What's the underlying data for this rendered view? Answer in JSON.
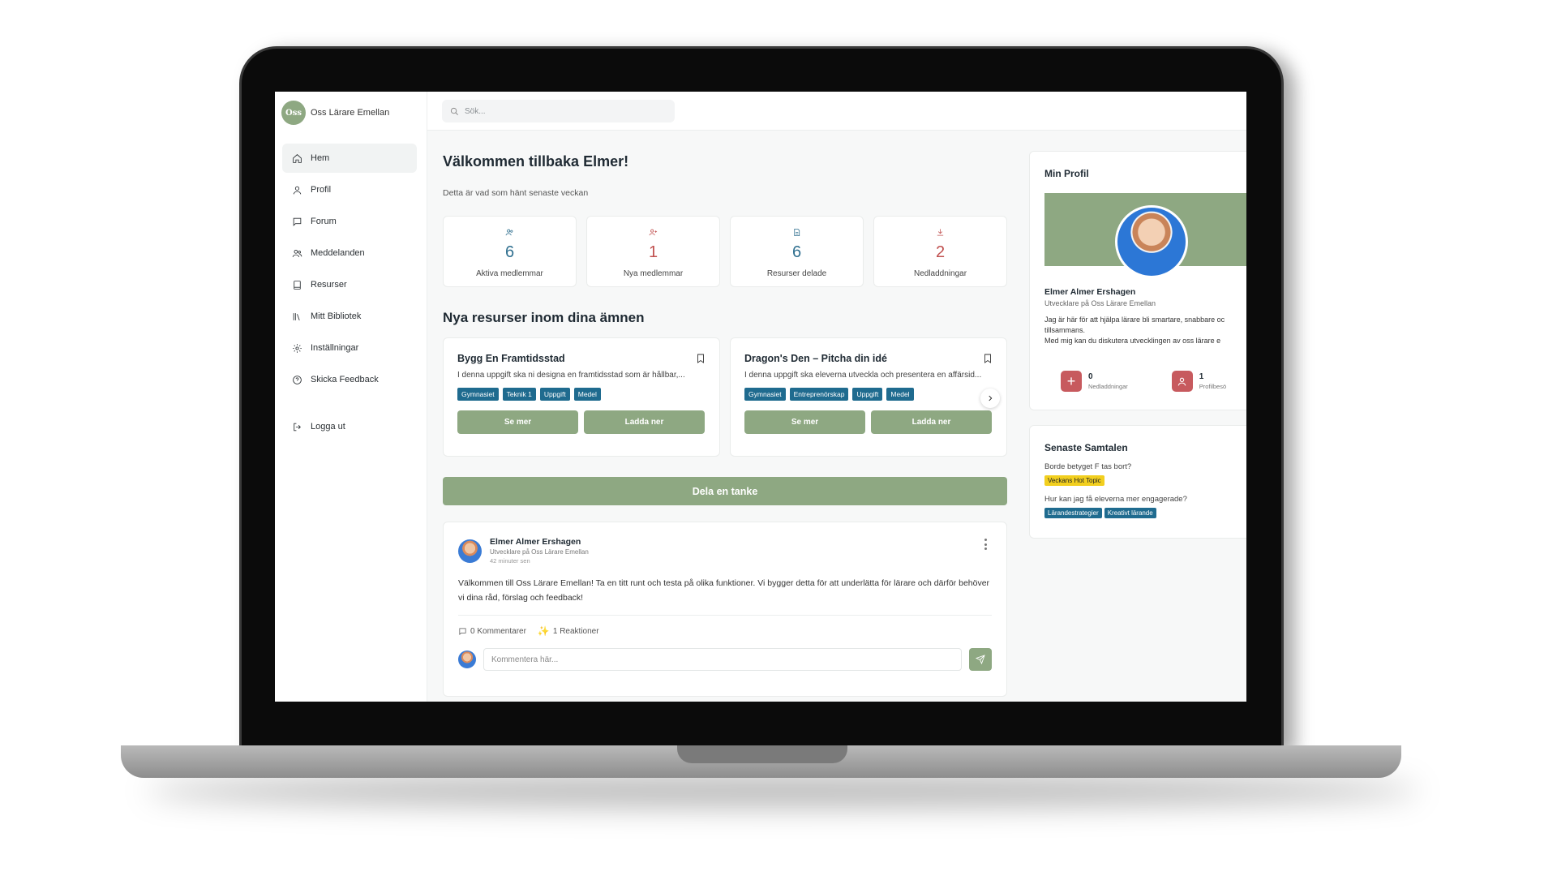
{
  "brand": {
    "logo_text": "Oss",
    "name": "Oss Lärare Emellan"
  },
  "search": {
    "placeholder": "Sök..."
  },
  "sidebar": {
    "items": [
      {
        "label": "Hem",
        "icon": "home-icon"
      },
      {
        "label": "Profil",
        "icon": "user-icon"
      },
      {
        "label": "Forum",
        "icon": "chat-icon"
      },
      {
        "label": "Meddelanden",
        "icon": "users-icon"
      },
      {
        "label": "Resurser",
        "icon": "book-icon"
      },
      {
        "label": "Mitt Bibliotek",
        "icon": "library-icon"
      },
      {
        "label": "Inställningar",
        "icon": "gear-icon"
      },
      {
        "label": "Skicka Feedback",
        "icon": "help-icon"
      }
    ],
    "logout": "Logga ut"
  },
  "main": {
    "welcome": "Välkommen tillbaka Elmer!",
    "subtitle": "Detta är vad som hänt senaste veckan",
    "stats": [
      {
        "value": "6",
        "label": "Aktiva medlemmar",
        "icon": "users-icon",
        "color": "#2f6f8f"
      },
      {
        "value": "1",
        "label": "Nya medlemmar",
        "icon": "user-plus-icon",
        "color": "#c0504f"
      },
      {
        "value": "6",
        "label": "Resurser delade",
        "icon": "file-icon",
        "color": "#2f6f8f"
      },
      {
        "value": "2",
        "label": "Nedladdningar",
        "icon": "download-icon",
        "color": "#c0504f"
      }
    ],
    "resources_title": "Nya resurser inom dina ämnen",
    "resources": [
      {
        "title": "Bygg En Framtidsstad",
        "description": "I denna uppgift ska ni designa en framtidsstad som är hållbar,...",
        "tags": [
          "Gymnasiet",
          "Teknik 1",
          "Uppgift",
          "Medel"
        ],
        "btn_more": "Se mer",
        "btn_download": "Ladda ner"
      },
      {
        "title": "Dragon's Den – Pitcha din idé",
        "description": "I denna uppgift ska eleverna utveckla och presentera en affärsid...",
        "tags": [
          "Gymnasiet",
          "Entreprenörskap",
          "Uppgift",
          "Medel"
        ],
        "btn_more": "Se mer",
        "btn_download": "Ladda ner"
      }
    ],
    "share_button": "Dela en tanke",
    "post": {
      "author": "Elmer Almer Ershagen",
      "role": "Utvecklare på Oss Lärare Emellan",
      "time": "42 minuter sen",
      "body": "Välkommen till Oss Lärare Emellan! Ta en titt runt och testa på olika funktioner. Vi bygger detta för att underlätta för lärare och därför behöver vi dina råd, förslag och feedback!",
      "comments": "0 Kommentarer",
      "reactions": "1 Reaktioner",
      "comment_placeholder": "Kommentera här..."
    }
  },
  "profile": {
    "title": "Min Profil",
    "name": "Elmer Almer Ershagen",
    "role": "Utvecklare på Oss Lärare Emellan",
    "bio_line1": "Jag är här för att hjälpa lärare bli smartare, snabbare oc",
    "bio_line2": "tillsammans.",
    "bio_line3": "Med mig kan du diskutera utvecklingen av oss lärare e",
    "stats": [
      {
        "value": "0",
        "label": "Nedladdningar"
      },
      {
        "value": "1",
        "label": "Profilbesö"
      }
    ]
  },
  "conversations": {
    "title": "Senaste Samtalen",
    "items": [
      {
        "question": "Borde betyget F tas bort?",
        "tags": [
          "Veckans Hot Topic"
        ]
      },
      {
        "question": "Hur kan jag få eleverna mer engagerade?",
        "tags": [
          "Lärandestrategier",
          "Kreativt lärande"
        ]
      }
    ]
  },
  "colors": {
    "accent_green": "#8ea882",
    "tag_blue": "#1f6b8f",
    "stat_blue": "#2f6f8f",
    "stat_red": "#c0504f",
    "hot_yellow": "#f2cf1f"
  }
}
